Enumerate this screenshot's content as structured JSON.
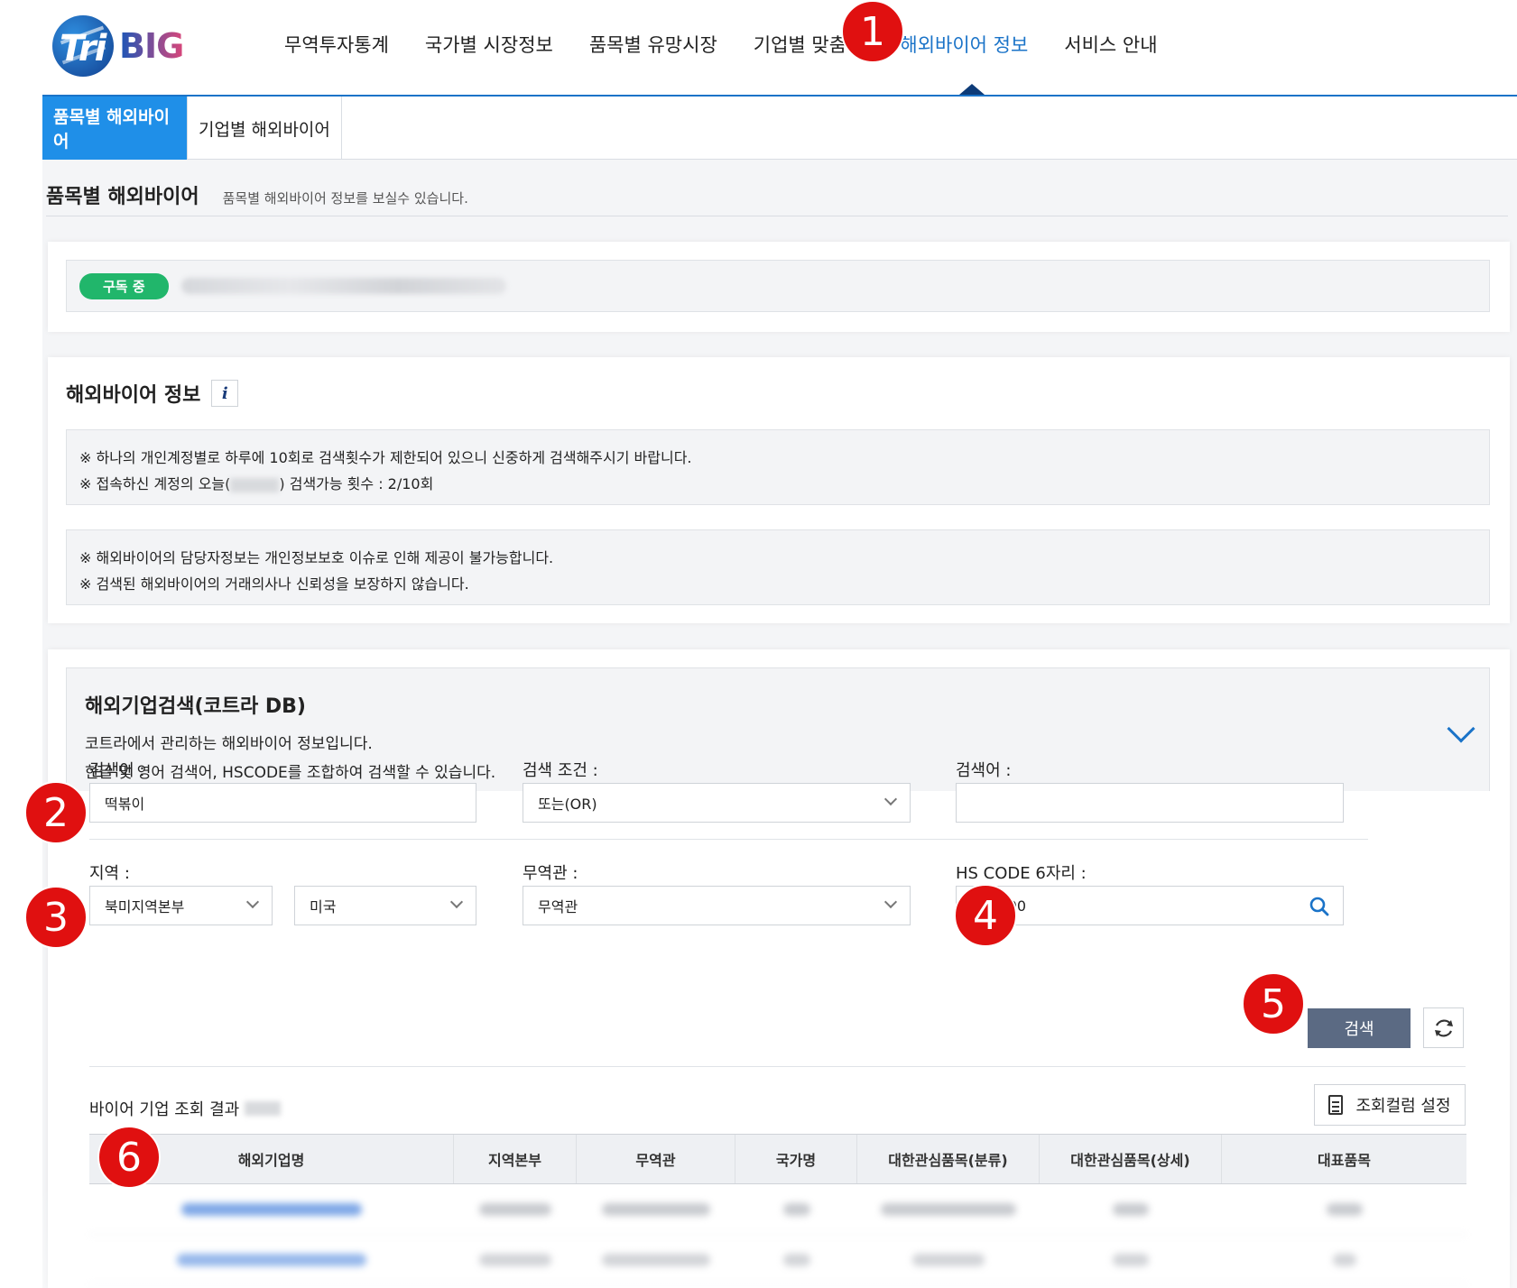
{
  "header": {
    "logo_text": "TriBIG",
    "nav": [
      "무역투자통계",
      "국가별 시장정보",
      "품목별 유망시장",
      "기업별 맞춤정",
      "해외바이어 정보",
      "서비스 안내"
    ],
    "active_nav_index": 4
  },
  "markers": [
    "1",
    "2",
    "3",
    "4",
    "5",
    "6"
  ],
  "subtabs": {
    "active": "품목별 해외바이어",
    "other": "기업별 해외바이어"
  },
  "page_head": {
    "title": "품목별 해외바이어",
    "desc": "품목별 해외바이어 정보를 보실수 있습니다."
  },
  "subscription": {
    "badge": "구독 중"
  },
  "buyer_info": {
    "title": "해외바이어 정보",
    "info_icon": "info-icon",
    "notice1_line1": "※ 하나의 개인계정별로 하루에 10회로 검색횟수가 제한되어 있으니 신중하게 검색해주시기 바랍니다.",
    "notice1_line2_prefix": "※ 접속하신 계정의 오늘(",
    "notice1_line2_suffix": ") 검색가능 횟수 : 2/10회",
    "notice2_line1": "※ 해외바이어의 담당자정보는 개인정보보호 이슈로 인해 제공이 불가능합니다.",
    "notice2_line2": "※ 검색된 해외바이어의 거래의사나 신뢰성을 보장하지 않습니다."
  },
  "search": {
    "title": "해외기업검색(코트라 DB)",
    "desc1": "코트라에서 관리하는 해외바이어 정보입니다.",
    "desc2": "한글 및 영어 검색어, HSCODE를 조합하여 검색할 수 있습니다.",
    "keyword_label": "검색어 :",
    "keyword_value": "떡볶이",
    "condition_label": "검색 조건 :",
    "condition_value": "또는(OR)",
    "keyword2_label": "검색어 :",
    "keyword2_value": "",
    "region_label": "지역 :",
    "region_value": "북미지역본부",
    "country_value": "미국",
    "office_label": "무역관 :",
    "office_value": "무역관",
    "hscode_label": "HS CODE 6자리 :",
    "hscode_value": "190190",
    "search_button": "검색"
  },
  "results": {
    "title": "바이어 기업 조회 결과",
    "column_setting_button": "조회컬럼 설정",
    "columns": [
      "해외기업명",
      "지역본부",
      "무역관",
      "국가명",
      "대한관심품목(분류)",
      "대한관심품목(상세)",
      "대표품목"
    ]
  }
}
